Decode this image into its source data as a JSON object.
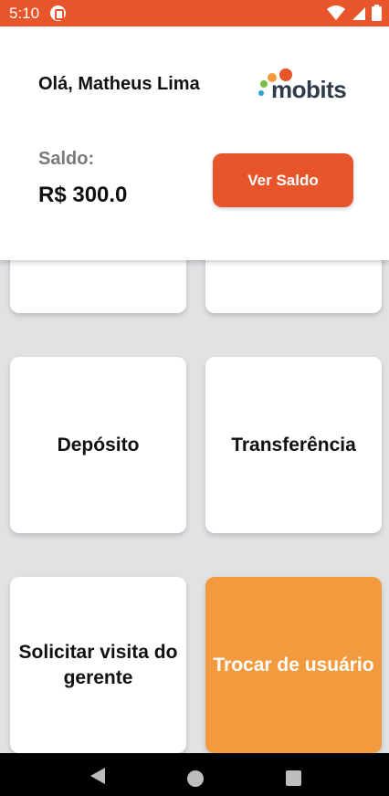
{
  "status_bar": {
    "time": "5:10",
    "icons": [
      "app-notification-icon",
      "wifi-icon",
      "cellular-signal-icon",
      "battery-icon"
    ],
    "background_color": "#e8552b"
  },
  "header": {
    "greeting": "Olá, Matheus Lima",
    "logo_text": "mobits",
    "balance_label": "Saldo:",
    "balance_value": "R$ 300.0",
    "see_balance_button": "Ver Saldo"
  },
  "menu": {
    "top_left_label": "",
    "top_right_label": "",
    "deposit_label": "Depósito",
    "transfer_label": "Transferência",
    "request_visit_label": "Solicitar visita do gerente",
    "switch_user_label": "Trocar de usuário"
  },
  "nav_bar": {
    "icons": [
      "back-icon",
      "home-icon",
      "recent-apps-icon"
    ]
  },
  "colors": {
    "accent": "#e8552b",
    "switch_user_card": "#f29a3d",
    "background": "#e2e2e5"
  }
}
